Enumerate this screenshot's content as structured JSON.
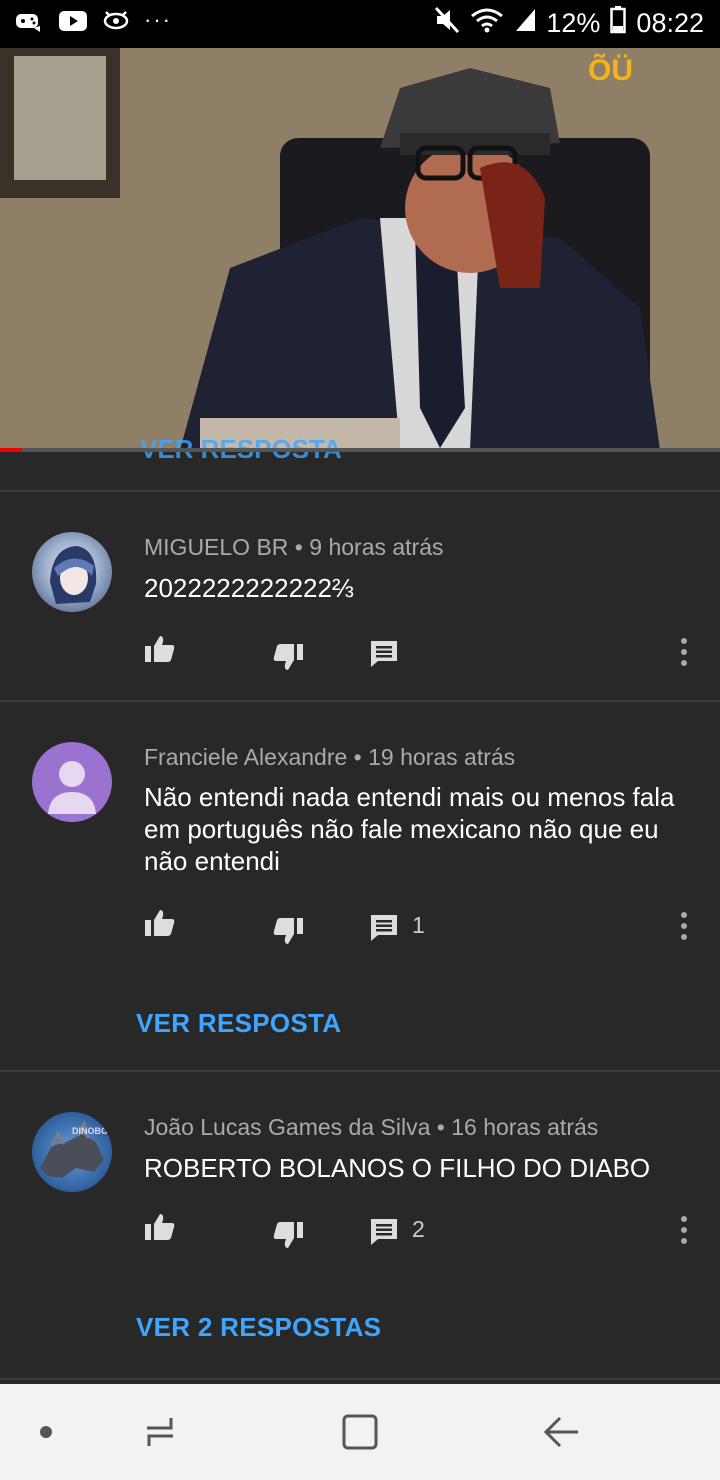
{
  "status_bar": {
    "battery": "12%",
    "time": "08:22",
    "more": "···"
  },
  "video": {
    "progress": 0.03,
    "peek_text": "VER RESPOSTA"
  },
  "comments": [
    {
      "author": "MIGUELO BR",
      "time": "9 horas atrás",
      "text": "2022222222222⅔",
      "reply_count": ""
    },
    {
      "author": "Franciele Alexandre",
      "time": "19 horas atrás",
      "text": "Não entendi nada entendi mais ou menos fala em português não fale mexicano não que eu não entendi",
      "reply_count": "1",
      "replies_link": "VER RESPOSTA"
    },
    {
      "author": "João Lucas Games da Silva",
      "time": "16 horas atrás",
      "text": "ROBERTO BOLANOS O FILHO DO DIABO",
      "reply_count": "2",
      "replies_link": "VER 2 RESPOSTAS"
    }
  ],
  "colors": {
    "background": "#282828",
    "link": "#3ea6ff",
    "progress": "#e00000",
    "avatar_purple": "#9b72cf"
  }
}
